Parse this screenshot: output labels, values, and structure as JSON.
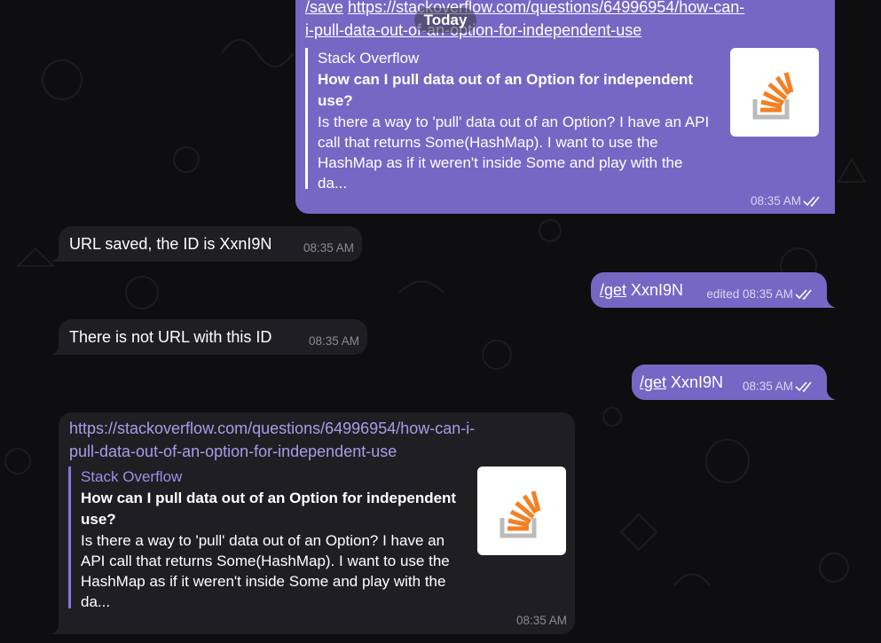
{
  "date_separator": "Today",
  "colors": {
    "outgoing_bubble": "#7667c4",
    "incoming_bubble": "#1f1f23",
    "background": "#0e0e10",
    "accent": "#8774e1"
  },
  "messages": [
    {
      "direction": "out",
      "command": "/save",
      "url_line1": "https://stackoverflow.com/questions/64996954/how-can-",
      "url_line2": "i-pull-data-out-of-an-option-for-independent-use",
      "preview": {
        "site": "Stack Overflow",
        "title_line1": "How can I pull data out of an Option for independent",
        "title_line2": "use?",
        "desc_line1": "Is there a way to 'pull' data out of an Option? I have an API",
        "desc_line2": "call that returns Some(HashMap). I want to use the",
        "desc_line3": "HashMap as if it weren't inside Some and play with the",
        "desc_line4": "da...",
        "thumbnail_icon": "stackoverflow-logo-icon"
      },
      "time": "08:35 AM",
      "status_icon": "double-check-icon"
    },
    {
      "direction": "in",
      "text": "URL saved, the ID is XxnI9N",
      "time": "08:35 AM"
    },
    {
      "direction": "out",
      "command": "/get",
      "text": " XxnI9N",
      "time": "edited 08:35 AM",
      "status_icon": "double-check-icon"
    },
    {
      "direction": "in",
      "text": "There is not URL with this ID",
      "time": "08:35 AM"
    },
    {
      "direction": "out",
      "command": "/get",
      "text": " XxnI9N",
      "time": "08:35 AM",
      "status_icon": "double-check-icon"
    },
    {
      "direction": "in",
      "url_line1": "https://stackoverflow.com/questions/64996954/how-can-i-",
      "url_line2": "pull-data-out-of-an-option-for-independent-use",
      "preview": {
        "site": "Stack Overflow",
        "title_line1": "How can I pull data out of an Option for independent",
        "title_line2": "use?",
        "desc_line1": "Is there a way to 'pull' data out of an Option? I have an",
        "desc_line2": "API call that returns Some(HashMap). I want to use the",
        "desc_line3": "HashMap as if it weren't inside Some and play with the",
        "desc_line4": "da...",
        "thumbnail_icon": "stackoverflow-logo-icon"
      },
      "time": "08:35 AM"
    }
  ]
}
